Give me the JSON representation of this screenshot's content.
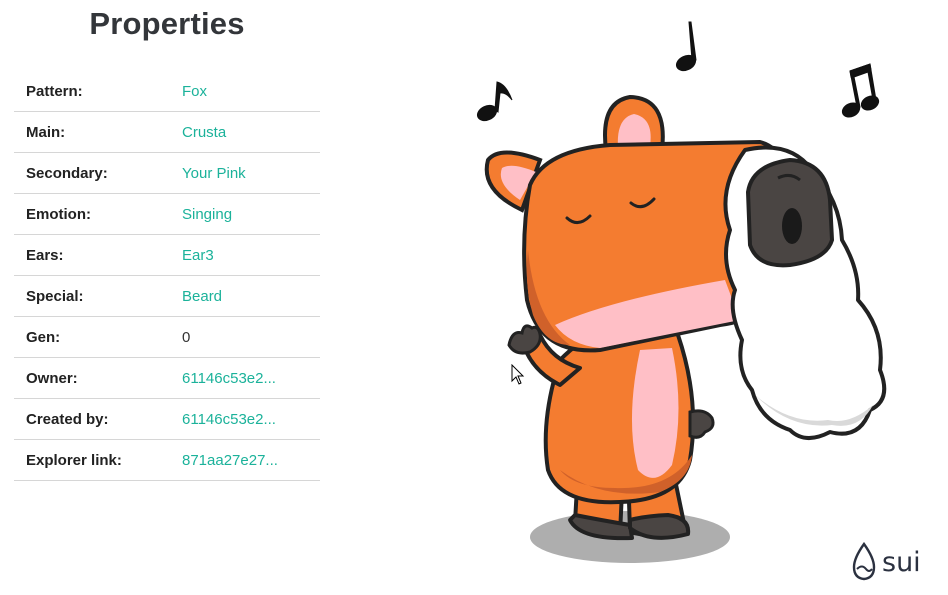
{
  "properties": {
    "title": "Properties",
    "rows": [
      {
        "key": "Pattern:",
        "value": "Fox"
      },
      {
        "key": "Main:",
        "value": "Crusta"
      },
      {
        "key": "Secondary:",
        "value": "Your Pink"
      },
      {
        "key": "Emotion:",
        "value": "Singing"
      },
      {
        "key": "Ears:",
        "value": "Ear3"
      },
      {
        "key": "Special:",
        "value": "Beard"
      },
      {
        "key": "Gen:",
        "value": "0"
      },
      {
        "key": "Owner:",
        "value": "61146c53e2..."
      },
      {
        "key": "Created by:",
        "value": "61146c53e2..."
      },
      {
        "key": "Explorer link:",
        "value": "871aa27e27..."
      }
    ]
  },
  "colors": {
    "accent_link": "#1bb29a",
    "body_orange": "#f47c30",
    "belly_pink": "#ffbfc6",
    "beard_white": "#ffffff",
    "outline": "#222222"
  },
  "illustration": {
    "icons": [
      "music-note-icon",
      "music-note-icon",
      "beamed-music-notes-icon",
      "capybara-illustration",
      "cursor-pointer-icon"
    ]
  },
  "brand": {
    "logo_text": "sui",
    "logo_icon": "sui-drop-icon"
  }
}
